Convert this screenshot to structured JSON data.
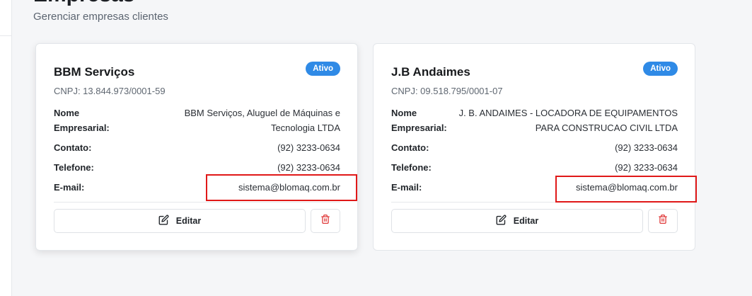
{
  "page": {
    "title": "Empresas",
    "subtitle": "Gerenciar empresas clientes"
  },
  "colors": {
    "badge": "#2f8ae6",
    "delete_icon": "#e03b3b",
    "highlight": "#e01818"
  },
  "labels": {
    "nome": "Nome",
    "empresarial": "Empresarial:",
    "contato": "Contato:",
    "telefone": "Telefone:",
    "email": "E-mail:",
    "edit": "Editar"
  },
  "companies": [
    {
      "name": "BBM Serviços",
      "status": "Ativo",
      "cnpj": "CNPJ: 13.844.973/0001-59",
      "razao_line1": "BBM Serviços, Aluguel de Máquinas e",
      "razao_line2": "Tecnologia LTDA",
      "contato": "(92) 3233-0634",
      "telefone": "(92) 3233-0634",
      "email": "sistema@blomaq.com.br"
    },
    {
      "name": "J.B Andaimes",
      "status": "Ativo",
      "cnpj": "CNPJ: 09.518.795/0001-07",
      "razao_line1": "J. B. ANDAIMES - LOCADORA DE EQUIPAMENTOS",
      "razao_line2": "PARA CONSTRUCAO CIVIL LTDA",
      "contato": "(92) 3233-0634",
      "telefone": "(92) 3233-0634",
      "email": "sistema@blomaq.com.br"
    }
  ],
  "icons": {
    "edit": "edit-icon",
    "delete": "trash-icon"
  }
}
